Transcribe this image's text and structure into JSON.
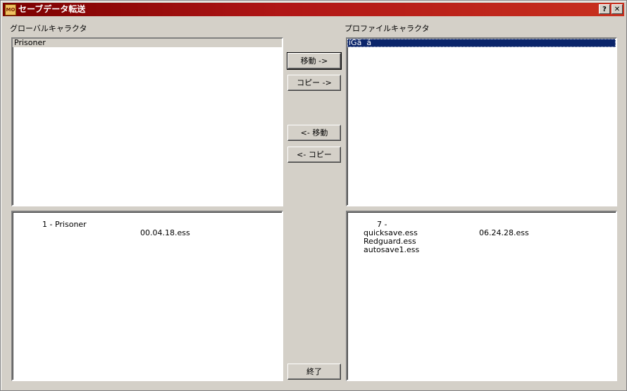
{
  "window": {
    "title": "セーブデータ転送",
    "icon_text": "MO",
    "help_label": "?",
    "close_label": "✕"
  },
  "global": {
    "label": "グローバルキャラクタ",
    "characters": [
      "Prisoner"
    ],
    "saves": [
      {
        "name": "1 - Prisoner",
        "time": "00.04.18.ess"
      }
    ]
  },
  "profile": {
    "label": "プロファイルキャラクタ",
    "characters": [
      "íGã  á"
    ],
    "saves": [
      {
        "name": "7 -",
        "time": "06.24.28.ess"
      },
      {
        "name": "quicksave.ess",
        "time": ""
      },
      {
        "name": "Redguard.ess",
        "time": ""
      },
      {
        "name": "autosave1.ess",
        "time": ""
      }
    ]
  },
  "buttons": {
    "move_right": "移動 ->",
    "copy_right": "コピー ->",
    "move_left": "<- 移動",
    "copy_left": "<- コピー",
    "close": "終了"
  }
}
